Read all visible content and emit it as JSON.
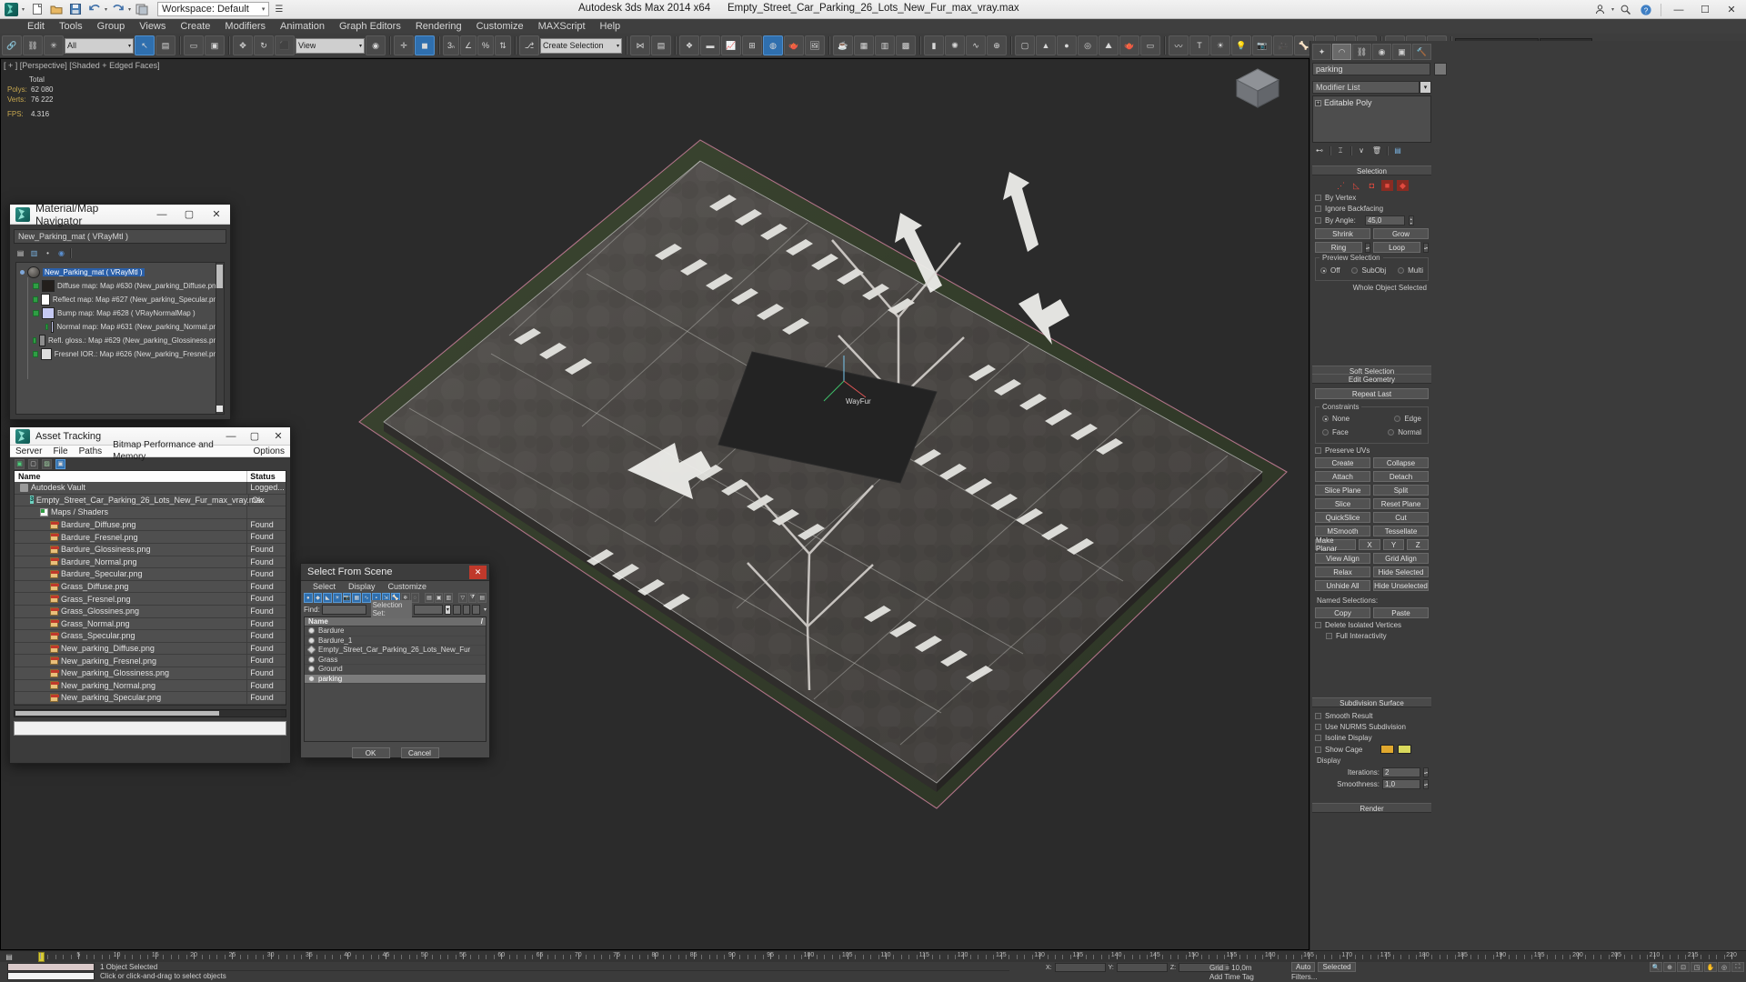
{
  "titlebar": {
    "app_title": "Autodesk 3ds Max  2014 x64",
    "file_name": "Empty_Street_Car_Parking_26_Lots_New_Fur_max_vray.max",
    "workspace_label": "Workspace: Default",
    "quick_icons": [
      "max-logo-icon",
      "new-file-icon",
      "open-file-icon",
      "save-file-icon",
      "undo-icon",
      "redo-icon",
      "set-project-folder-icon"
    ],
    "info_icons": [
      "sign-in-icon",
      "search-help-icon",
      "help-icon"
    ],
    "window_buttons": {
      "minimize": "—",
      "maximize": "☐",
      "close": "✕"
    }
  },
  "menubar": {
    "items": [
      "Edit",
      "Tools",
      "Group",
      "Views",
      "Create",
      "Modifiers",
      "Animation",
      "Graph Editors",
      "Rendering",
      "Customize",
      "MAXScript",
      "Help"
    ]
  },
  "toolbar": {
    "selection_filter": "All",
    "named_selection": "Create Selection",
    "view_coord": "View",
    "ref_coord": "",
    "snap_label": "3",
    "angle_label": "%",
    "buttons": [
      "select-link-icon",
      "unlink-icon",
      "bind-space-warp-icon",
      "select-object-icon",
      "select-by-name-icon",
      "rect-selection-region-icon",
      "window-crossing-icon",
      "select-and-move-icon",
      "select-and-rotate-icon",
      "select-and-scale-icon",
      "use-pivot-center-icon",
      "select-and-manipulate-icon",
      "snaps-toggle-icon",
      "angle-snap-icon",
      "percent-snap-icon",
      "spinner-snap-icon",
      "edit-named-selection-icon",
      "mirror-icon",
      "align-icon",
      "layer-manager-icon",
      "ribbon-icon",
      "curve-editor-icon",
      "schematic-view-icon",
      "material-editor-icon",
      "render-setup-icon",
      "rendered-frame-icon",
      "render-production-icon"
    ]
  },
  "viewport": {
    "label": "[ + ] [Perspective] [Shaded + Edged Faces]",
    "stats": {
      "total_label": "Total",
      "polys_label": "Polys:",
      "polys_value": "62 080",
      "verts_label": "Verts:",
      "verts_value": "76 222",
      "fps_label": "FPS:",
      "fps_value": "4.316"
    },
    "object_label": "WayFur",
    "viewcube_label": "viewcube-icon"
  },
  "command_panel": {
    "tabs": [
      "create-tab",
      "modify-tab",
      "hierarchy-tab",
      "motion-tab",
      "display-tab",
      "utilities-tab"
    ],
    "active_tab_index": 1,
    "object_name": "parking",
    "modifier_list_label": "Modifier List",
    "stack": [
      "Editable Poly"
    ],
    "stack_buttons": [
      "pin-stack-icon",
      "show-end-result-icon",
      "make-unique-icon",
      "remove-modifier-icon",
      "configure-sets-icon"
    ],
    "rollouts": [
      {
        "title": "Selection",
        "sub_object_modes": [
          "vertex-icon",
          "edge-icon",
          "border-icon",
          "polygon-icon",
          "element-icon"
        ],
        "checkboxes": [
          {
            "label": "By Vertex",
            "checked": false
          },
          {
            "label": "Ignore Backfacing",
            "checked": false
          },
          {
            "label": "By Angle:",
            "checked": false
          }
        ],
        "angle_value": "45,0",
        "buttons": [
          "Shrink",
          "Grow",
          "Ring",
          "Loop"
        ],
        "preview_group_label": "Preview Selection",
        "preview_options": [
          "Off",
          "SubObj",
          "Multi"
        ],
        "preview_selected": "Off",
        "status": "Whole Object Selected"
      },
      {
        "title": "Soft Selection"
      },
      {
        "title": "Edit Geometry",
        "repeat_label": "Repeat Last",
        "constraints_label": "Constraints",
        "constraint_options": [
          "None",
          "Edge",
          "Face",
          "Normal"
        ],
        "constraint_selected": "None",
        "preserve_uv_label": "Preserve UVs",
        "buttons": [
          "Create",
          "Collapse",
          "Attach",
          "Detach",
          "Slice Plane",
          "Split",
          "Slice",
          "Reset Plane",
          "QuickSlice",
          "Cut",
          "MSmooth",
          "Tessellate",
          "Make Planar",
          "X",
          "Y",
          "Z",
          "View Align",
          "Grid Align",
          "Relax",
          "Hide Selected",
          "Unhide All",
          "Hide Unselected",
          "Copy",
          "Paste"
        ],
        "named_selections_label": "Named Selections:",
        "delete_isolated_label": "Delete Isolated Vertices",
        "full_interactivity_label": "Full Interactivity"
      },
      {
        "title": "Subdivision Surface",
        "checkboxes": [
          "Smooth Result",
          "Use NURMS Subdivision",
          "Isoline Display",
          "Show Cage"
        ],
        "display_label": "Display",
        "iterations_label": "Iterations:",
        "iterations_value": "2",
        "smoothness_label": "Smoothness:",
        "smoothness_value": "1,0",
        "cage_color_1": "#e0a82e",
        "cage_color_2": "#d9d95c"
      },
      {
        "title": "Render"
      }
    ]
  },
  "material_map_navigator": {
    "title": "Material/Map Navigator",
    "field_value": "New_Parking_mat  ( VRayMtl )",
    "toolbar_icons": [
      "view-list-icon",
      "view-details-icon",
      "small-icons-icon",
      "large-icons-icon"
    ],
    "tree": [
      {
        "label": "New_Parking_mat  ( VRayMtl )",
        "selected": true,
        "depth": 0,
        "swatch": "#6c6a67"
      },
      {
        "label": "Diffuse map: Map #630 (New_parking_Diffuse.png)",
        "depth": 1,
        "swatch": "#231f1c"
      },
      {
        "label": "Reflect map: Map #627 (New_parking_Specular.png)",
        "depth": 1,
        "swatch": "#ffffff"
      },
      {
        "label": "Bump map: Map #628  ( VRayNormalMap )",
        "depth": 1,
        "swatch": "#c5c9f2"
      },
      {
        "label": "Normal map: Map #631 (New_parking_Normal.png)",
        "depth": 2,
        "swatch": "#c8cbf0"
      },
      {
        "label": "Refl. gloss.: Map #629 (New_parking_Glossiness.png)",
        "depth": 1,
        "swatch": "#8d8d8d"
      },
      {
        "label": "Fresnel IOR.: Map #626 (New_parking_Fresnel.png)",
        "depth": 1,
        "swatch": "#dedede"
      }
    ]
  },
  "asset_tracking": {
    "title": "Asset Tracking",
    "menu": [
      "Server",
      "File",
      "Paths",
      "Bitmap Performance and Memory",
      "Options"
    ],
    "toolbar_icons": [
      "check-in-icon",
      "check-out-icon",
      "get-latest-icon",
      "refresh-icon"
    ],
    "columns": [
      "Name",
      "Status"
    ],
    "rows": [
      {
        "name": "Autodesk Vault",
        "status": "Logged...",
        "indent": 0,
        "icon": "vault"
      },
      {
        "name": "Empty_Street_Car_Parking_26_Lots_New_Fur_max_vray.max",
        "status": "Ok",
        "indent": 1,
        "icon": "max"
      },
      {
        "name": "Maps / Shaders",
        "status": "",
        "indent": 2,
        "icon": "folder"
      },
      {
        "name": "Bardure_Diffuse.png",
        "status": "Found",
        "indent": 3,
        "icon": "png"
      },
      {
        "name": "Bardure_Fresnel.png",
        "status": "Found",
        "indent": 3,
        "icon": "png"
      },
      {
        "name": "Bardure_Glossiness.png",
        "status": "Found",
        "indent": 3,
        "icon": "png"
      },
      {
        "name": "Bardure_Normal.png",
        "status": "Found",
        "indent": 3,
        "icon": "png"
      },
      {
        "name": "Bardure_Specular.png",
        "status": "Found",
        "indent": 3,
        "icon": "png"
      },
      {
        "name": "Grass_Diffuse.png",
        "status": "Found",
        "indent": 3,
        "icon": "png"
      },
      {
        "name": "Grass_Fresnel.png",
        "status": "Found",
        "indent": 3,
        "icon": "png"
      },
      {
        "name": "Grass_Glossines.png",
        "status": "Found",
        "indent": 3,
        "icon": "png"
      },
      {
        "name": "Grass_Normal.png",
        "status": "Found",
        "indent": 3,
        "icon": "png"
      },
      {
        "name": "Grass_Specular.png",
        "status": "Found",
        "indent": 3,
        "icon": "png"
      },
      {
        "name": "New_parking_Diffuse.png",
        "status": "Found",
        "indent": 3,
        "icon": "png"
      },
      {
        "name": "New_parking_Fresnel.png",
        "status": "Found",
        "indent": 3,
        "icon": "png"
      },
      {
        "name": "New_parking_Glossiness.png",
        "status": "Found",
        "indent": 3,
        "icon": "png"
      },
      {
        "name": "New_parking_Normal.png",
        "status": "Found",
        "indent": 3,
        "icon": "png"
      },
      {
        "name": "New_parking_Specular.png",
        "status": "Found",
        "indent": 3,
        "icon": "png"
      }
    ]
  },
  "select_from_scene": {
    "title": "Select From Scene",
    "menu": [
      "Select",
      "Display",
      "Customize"
    ],
    "find_label": "Find:",
    "find_value": "",
    "selection_set_label": "Selection Set:",
    "selection_set_value": "",
    "list_header": "Name",
    "items": [
      {
        "name": "Bardure",
        "selected": false,
        "icon": "geometry"
      },
      {
        "name": "Bardure_1",
        "selected": false,
        "icon": "geometry"
      },
      {
        "name": "Empty_Street_Car_Parking_26_Lots_New_Fur",
        "selected": false,
        "icon": "group"
      },
      {
        "name": "Grass",
        "selected": false,
        "icon": "geometry"
      },
      {
        "name": "Ground",
        "selected": false,
        "icon": "geometry"
      },
      {
        "name": "parking",
        "selected": true,
        "icon": "geometry"
      }
    ],
    "ok_label": "OK",
    "cancel_label": "Cancel"
  },
  "statusbar": {
    "selection_text": "1 Object Selected",
    "prompt_text": "Click or click-and-drag to select objects",
    "coords": {
      "x_label": "X:",
      "y_label": "Y:",
      "z_label": "Z:",
      "x": "",
      "y": "",
      "z": ""
    },
    "grid_text": "Grid = 10,0m",
    "auto_key_label": "Auto",
    "set_key_label": "Selected",
    "add_time_tag": "Add Time Tag",
    "key_filters_label": "Filters...",
    "frame_field": "0 / 220",
    "time_start": "0",
    "time_end": "220"
  },
  "timeline": {
    "ticks": [
      0,
      5,
      10,
      15,
      20,
      25,
      30,
      35,
      40,
      45,
      50,
      55,
      60,
      65,
      70,
      75,
      80,
      85,
      90,
      95,
      100,
      105,
      110,
      115,
      120,
      125,
      130,
      135,
      140,
      145,
      150,
      155,
      160,
      165,
      170,
      175,
      180,
      185,
      190,
      195,
      200,
      205,
      210,
      215,
      220
    ],
    "current_frame": 0
  },
  "colors": {
    "accent_blue": "#2f6fae",
    "panel_bg": "#3b3b3b",
    "viewport_bg": "#2b2b2b",
    "selection_red": "#e04a3f",
    "found_green": "#2f9e44"
  }
}
